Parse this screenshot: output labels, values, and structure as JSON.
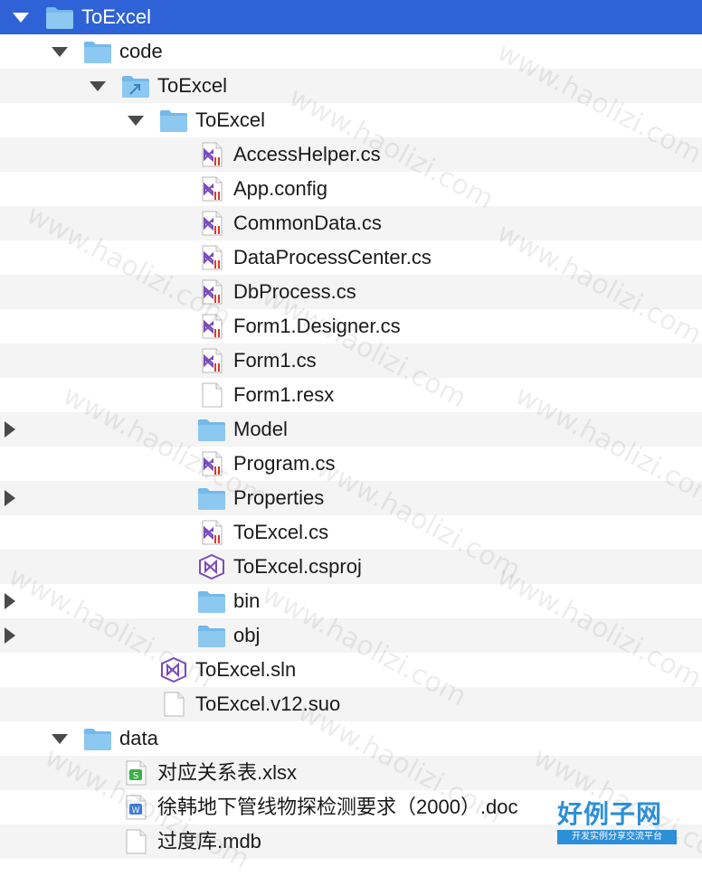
{
  "tree": [
    {
      "label": "ToExcel",
      "type": "folder",
      "disclosure": "open",
      "selected": true
    },
    {
      "label": "code",
      "type": "folder",
      "disclosure": "open"
    },
    {
      "label": "ToExcel",
      "type": "folder-alias",
      "disclosure": "open"
    },
    {
      "label": "ToExcel",
      "type": "folder",
      "disclosure": "open"
    },
    {
      "label": "AccessHelper.cs",
      "type": "cs-file"
    },
    {
      "label": "App.config",
      "type": "cs-file"
    },
    {
      "label": "CommonData.cs",
      "type": "cs-file"
    },
    {
      "label": "DataProcessCenter.cs",
      "type": "cs-file"
    },
    {
      "label": "DbProcess.cs",
      "type": "cs-file"
    },
    {
      "label": "Form1.Designer.cs",
      "type": "cs-file"
    },
    {
      "label": "Form1.cs",
      "type": "cs-file"
    },
    {
      "label": "Form1.resx",
      "type": "blank-file"
    },
    {
      "label": "Model",
      "type": "folder",
      "disclosure": "closed"
    },
    {
      "label": "Program.cs",
      "type": "cs-file"
    },
    {
      "label": "Properties",
      "type": "folder",
      "disclosure": "closed"
    },
    {
      "label": "ToExcel.cs",
      "type": "cs-file"
    },
    {
      "label": "ToExcel.csproj",
      "type": "vs-project"
    },
    {
      "label": "bin",
      "type": "folder",
      "disclosure": "closed"
    },
    {
      "label": "obj",
      "type": "folder",
      "disclosure": "closed"
    },
    {
      "label": "ToExcel.sln",
      "type": "vs-project"
    },
    {
      "label": "ToExcel.v12.suo",
      "type": "blank-file"
    },
    {
      "label": "data",
      "type": "folder",
      "disclosure": "open"
    },
    {
      "label": "对应关系表.xlsx",
      "type": "sheet-file"
    },
    {
      "label": "徐韩地下管线物探检测要求（2000）.doc",
      "type": "word-file"
    },
    {
      "label": "过度库.mdb",
      "type": "blank-file"
    }
  ],
  "watermark": {
    "text": "www.haolizi.com"
  },
  "logo": {
    "title": "好例子网",
    "subtitle": "开发实例分享交流平台"
  },
  "colors": {
    "selection": "#2f62d6",
    "folder": "#8cc8f0",
    "stripe": "#f4f4f4",
    "vs_purple": "#7a4bbf",
    "logo_blue": "#2c8fd9"
  }
}
